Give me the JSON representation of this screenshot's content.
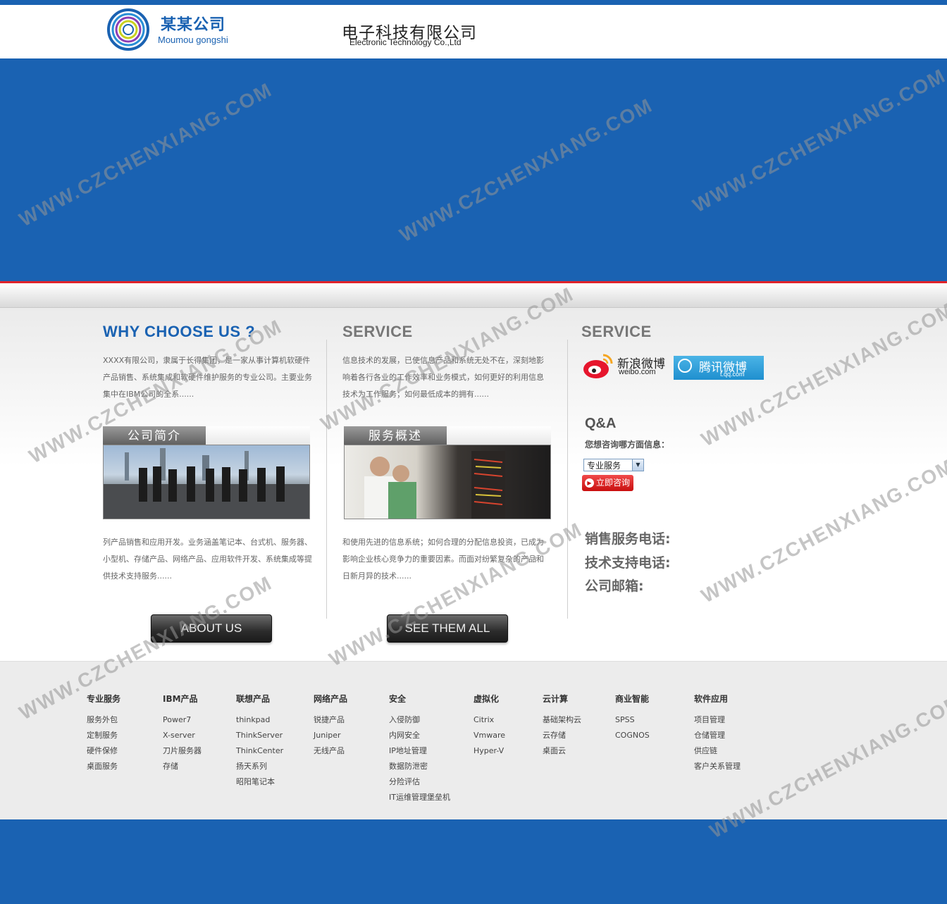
{
  "header": {
    "logo_cn": "某某公司",
    "logo_en": "Moumou gongshi",
    "company_cn": "电子科技有限公司",
    "company_en": "Electronic Technology Co.,Ltd"
  },
  "colors": {
    "brand_blue": "#1a62b2",
    "accent_red": "#e0232a"
  },
  "col1": {
    "heading": "WHY CHOOSE US ?",
    "intro": "XXXX有限公司，隶属于长得集团，是一家从事计算机软硬件产品销售、系统集成和软硬件维护服务的专业公司。主要业务集中在IBM公司的全系......",
    "image_tab": "公司简介",
    "body": "列产品销售和应用开发。业务涵盖笔记本、台式机、服务器、小型机、存储产品、网络产品、应用软件开发、系统集成等提供技术支持服务......",
    "button": "ABOUT US"
  },
  "col2": {
    "heading": "SERVICE",
    "intro": "信息技术的发展，已使信息产品和系统无处不在，深刻地影响着各行各业的工作效率和业务模式，如何更好的利用信息技术为工作服务；如何最低成本的拥有......",
    "image_tab": "服务概述",
    "body": "和使用先进的信息系统；如何合理的分配信息投资，已成为影响企业核心竞争力的重要因素。而面对纷繁复杂的产品和日新月异的技术......",
    "button": "SEE THEM ALL"
  },
  "col3": {
    "heading": "SERVICE",
    "weibo_cn": "新浪微博",
    "weibo_en": "weibo.com",
    "tqq_cn": "腾讯微博",
    "tqq_en": "t.qq.com",
    "qa_title": "Q&A",
    "qa_ask": "您想咨询哪方面信息：",
    "select_value": "专业服务",
    "consult_button": "立即咨询",
    "sales_phone": "销售服务电话:",
    "tech_phone": "技术支持电话:",
    "email": "公司邮箱:"
  },
  "footer": {
    "columns": [
      {
        "title": "专业服务",
        "items": [
          "服务外包",
          "定制服务",
          "硬件保修",
          "桌面服务"
        ]
      },
      {
        "title": "IBM产品",
        "items": [
          "Power7",
          "X-server",
          "刀片服务器",
          "存储"
        ]
      },
      {
        "title": "联想产品",
        "items": [
          "thinkpad",
          "ThinkServer",
          "ThinkCenter",
          "扬天系列",
          "昭阳笔记本"
        ]
      },
      {
        "title": "网络产品",
        "items": [
          "锐捷产品",
          "Juniper",
          "无线产品"
        ]
      },
      {
        "title": "安全",
        "items": [
          "入侵防御",
          "内网安全",
          "IP地址管理",
          "数据防泄密",
          "分险评估",
          "IT运维管理堡垒机"
        ]
      },
      {
        "title": "虚拟化",
        "items": [
          "Citrix",
          "Vmware",
          "Hyper-V"
        ]
      },
      {
        "title": "云计算",
        "items": [
          "基础架构云",
          "云存储",
          "桌面云"
        ]
      },
      {
        "title": "商业智能",
        "items": [
          "SPSS",
          "COGNOS"
        ]
      },
      {
        "title": "软件应用",
        "items": [
          "项目管理",
          "仓储管理",
          "供应链",
          "客户关系管理"
        ]
      }
    ]
  },
  "watermark": "WWW.CZCHENXIANG.COM"
}
